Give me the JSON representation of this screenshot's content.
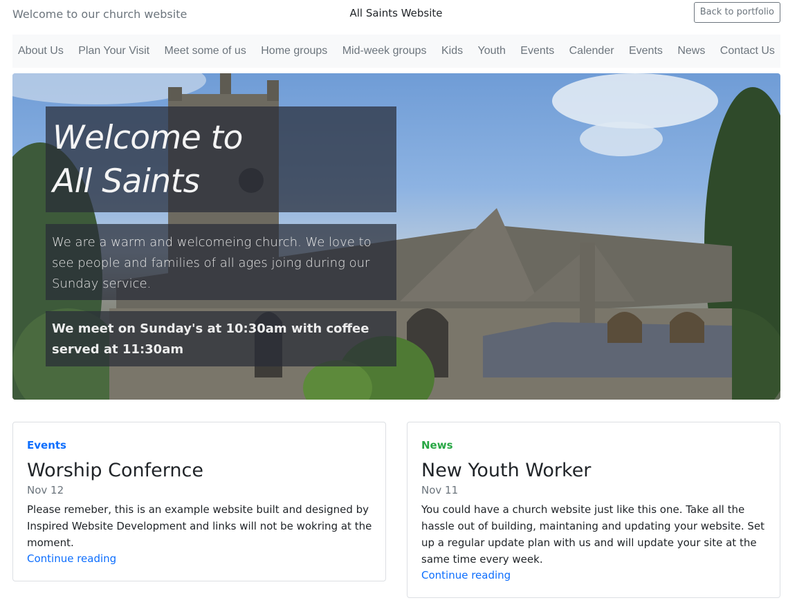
{
  "header": {
    "tagline": "Welcome to our church website",
    "site_title": "All Saints Website",
    "back_button": "Back to portfolio"
  },
  "nav": {
    "items": [
      {
        "label": "About Us"
      },
      {
        "label": "Plan Your Visit"
      },
      {
        "label": "Meet some of us"
      },
      {
        "label": "Home groups"
      },
      {
        "label": "Mid-week groups"
      },
      {
        "label": "Kids"
      },
      {
        "label": "Youth"
      },
      {
        "label": "Events"
      },
      {
        "label": "Calender"
      },
      {
        "label": "Events"
      },
      {
        "label": "News"
      },
      {
        "label": "Contact Us"
      }
    ]
  },
  "hero": {
    "title_line1": "Welcome to",
    "title_line2": "All Saints",
    "intro": "We are a warm and welcomeing church. We love to see people and families of all ages joing during our Sunday service.",
    "meeting": "We meet on Sunday's at 10:30am with coffee served at 11:30am"
  },
  "cards": [
    {
      "category": "Events",
      "category_color": "#0d6efd",
      "title": "Worship Confernce",
      "date": "Nov 12",
      "text": "Please remeber, this is an example website built and designed by Inspired Website Development and links will not be wokring at the moment.",
      "link": "Continue reading"
    },
    {
      "category": "News",
      "category_color": "#28a745",
      "title": "New Youth Worker",
      "date": "Nov 11",
      "text": "You could have a church website just like this one. Take all the hassle out of building, maintaning and updating your website. Set up a regular update plan with us and will update your site at the same time every week.",
      "link": "Continue reading"
    }
  ]
}
